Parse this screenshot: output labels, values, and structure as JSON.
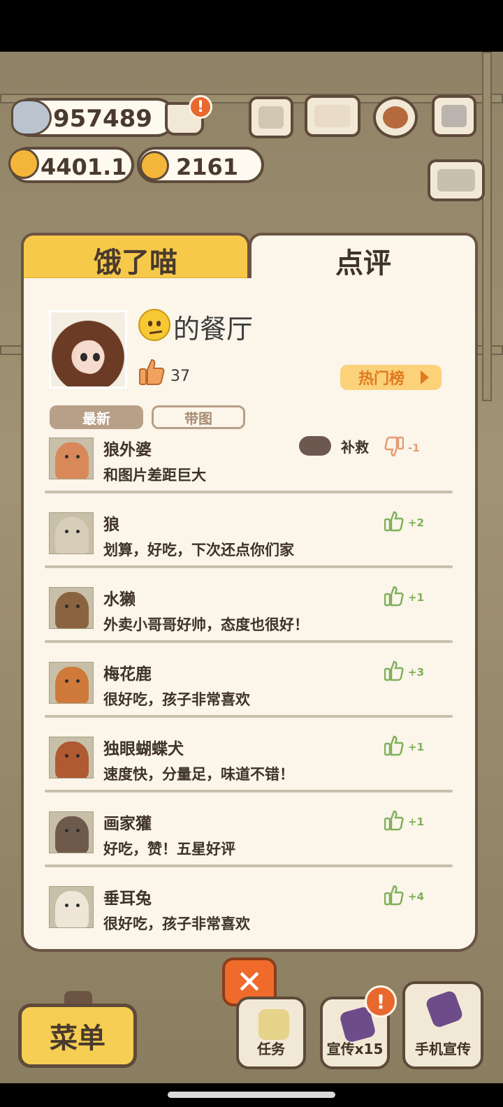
{
  "currencies": {
    "fish": "957489",
    "stars": "4401.1",
    "bells": "2161"
  },
  "badges": {
    "cart": "!",
    "promo": "!"
  },
  "tabs": {
    "hungry": "饿了喵",
    "review": "点评"
  },
  "restaurant": {
    "name": "的餐厅",
    "likes": "37",
    "hot_list": "热门榜"
  },
  "filters": {
    "newest": "最新",
    "with_pics": "带图"
  },
  "reviews": [
    {
      "name": "狼外婆",
      "text": "和图片差距巨大",
      "delta": "-1",
      "remedy": "补救",
      "color": "#d9885a"
    },
    {
      "name": "狼",
      "text": "划算，好吃，下次还点你们家",
      "delta": "+2",
      "color": "#d8cdb9"
    },
    {
      "name": "水獭",
      "text": "外卖小哥哥好帅，态度也很好！",
      "delta": "+1",
      "color": "#8a6440"
    },
    {
      "name": "梅花鹿",
      "text": "很好吃，孩子非常喜欢",
      "delta": "+3",
      "color": "#cf7a3a"
    },
    {
      "name": "独眼蝴蝶犬",
      "text": "速度快，分量足，味道不错！",
      "delta": "+1",
      "color": "#b05a32"
    },
    {
      "name": "画家獾",
      "text": "好吃，赞！五星好评",
      "delta": "+1",
      "color": "#6e5a4a"
    },
    {
      "name": "垂耳兔",
      "text": "很好吃，孩子非常喜欢",
      "delta": "+4",
      "color": "#efe6d8"
    }
  ],
  "bottom": {
    "close": "✕",
    "menu": "菜单",
    "tasks": "任务",
    "promote": "宣传x15",
    "phone_promo": "手机宣传"
  }
}
